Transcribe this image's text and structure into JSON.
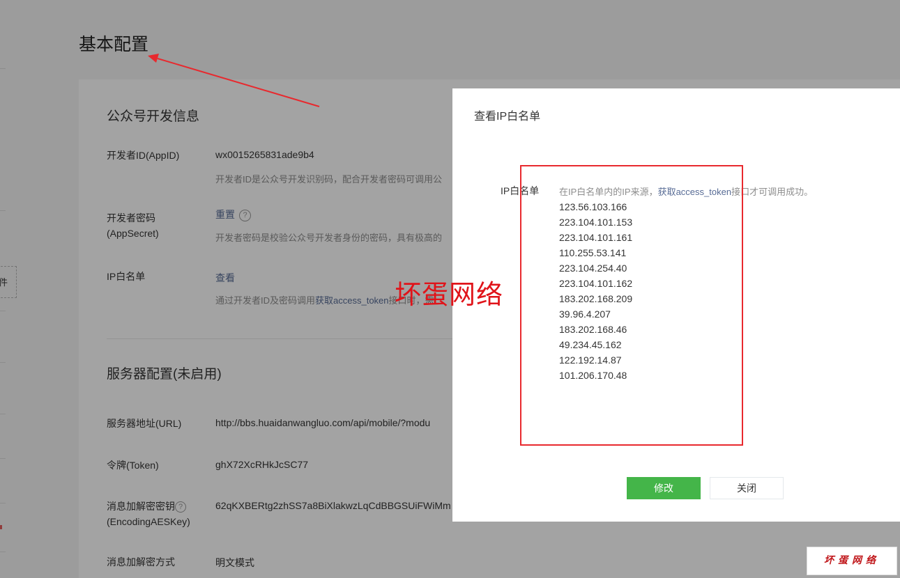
{
  "page": {
    "title": "基本配置",
    "left_box_text": "件"
  },
  "dev_info": {
    "section_title": "公众号开发信息",
    "appid_label": "开发者ID(AppID)",
    "appid_value": "wx0015265831ade9b4",
    "appid_desc": "开发者ID是公众号开发识别码，配合开发者密码可调用公",
    "secret_label_1": "开发者密码",
    "secret_label_2": "(AppSecret)",
    "secret_reset": "重置",
    "secret_desc": "开发者密码是校验公众号开发者身份的密码，具有极高的",
    "ip_label": "IP白名单",
    "ip_view": "查看",
    "ip_desc_prefix": "通过开发者ID及密码调用",
    "ip_desc_link": "获取access_token",
    "ip_desc_suffix": "接口时，需"
  },
  "server": {
    "section_title": "服务器配置(未启用)",
    "url_label": "服务器地址(URL)",
    "url_value": "http://bbs.huaidanwangluo.com/api/mobile/?modu",
    "token_label": "令牌(Token)",
    "token_value": "ghX72XcRHkJcSC77",
    "aes_label_1": "消息加解密密钥",
    "aes_label_2": "(EncodingAESKey)",
    "aes_value": "62qKXBERtg2zhSS7a8BiXlakwzLqCdBBGSUiFWiMm",
    "mode_label": "消息加解密方式",
    "mode_value": "明文模式"
  },
  "dialog": {
    "title": "查看IP白名单",
    "ip_label": "IP白名单",
    "desc_prefix": "在IP白名单内的IP来源，",
    "desc_link": "获取access_token",
    "desc_suffix": "接口才可调用成功。",
    "ips": [
      "123.56.103.166",
      "223.104.101.153",
      "223.104.101.161",
      "110.255.53.141",
      "223.104.254.40",
      "223.104.101.162",
      "183.202.168.209",
      "39.96.4.207",
      "183.202.168.46",
      "49.234.45.162",
      "122.192.14.87",
      "101.206.170.48"
    ],
    "modify_button": "修改",
    "close_button": "关闭"
  },
  "watermark": {
    "center": "坏蛋网络",
    "corner": "坏蛋网络"
  },
  "colors": {
    "primary_green": "#44b549",
    "link_blue": "#576b95",
    "annotation_red": "#e8292e",
    "watermark_red": "#e0141a"
  }
}
